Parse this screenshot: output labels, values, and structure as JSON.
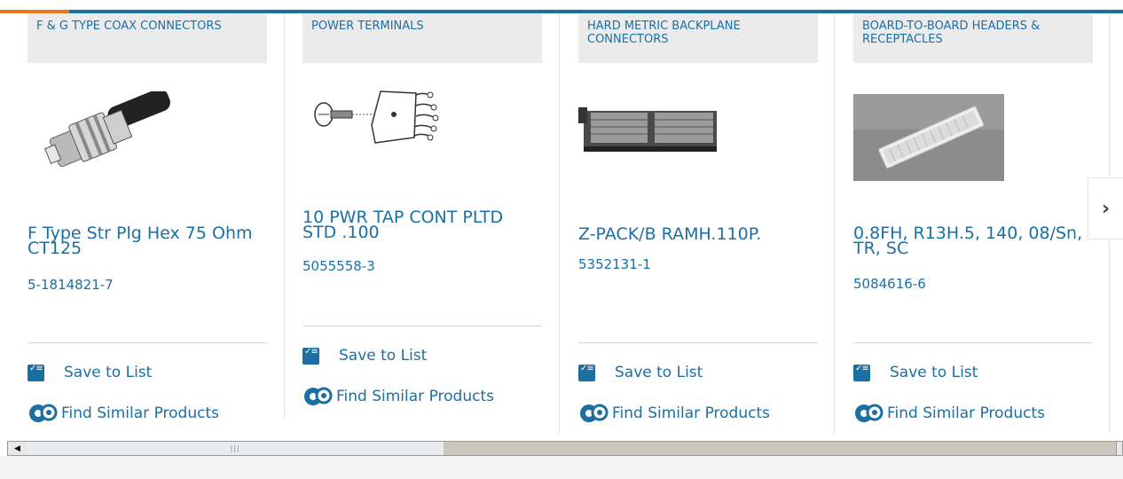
{
  "cards": [
    {
      "category": "F & G TYPE COAX CONNECTORS",
      "title": "F Type Str Plg Hex 75 Ohm CT125",
      "part_number": "5-1814821-7",
      "save_label": "Save to List",
      "similar_label": "Find Similar Products"
    },
    {
      "category": "POWER TERMINALS",
      "title": "10 PWR TAP CONT PLTD STD .100",
      "part_number": "5055558-3",
      "save_label": "Save to List",
      "similar_label": "Find Similar Products"
    },
    {
      "category": "HARD METRIC BACKPLANE CONNECTORS",
      "title": "Z-PACK/B RAMH.110P.",
      "part_number": "5352131-1",
      "save_label": "Save to List",
      "similar_label": "Find Similar Products"
    },
    {
      "category": "BOARD-TO-BOARD HEADERS & RECEPTACLES",
      "title": "0.8FH, R13H.5, 140, 08/Sn, TR, SC",
      "part_number": "5084616-6",
      "save_label": "Save to List",
      "similar_label": "Find Similar Products"
    }
  ],
  "icons": {
    "save": "checklist-icon",
    "similar": "gears-icon",
    "next": "chevron-right-icon"
  },
  "colors": {
    "link": "#1c6fa3",
    "accent": "#e87722",
    "brand": "#1a6fa3"
  }
}
